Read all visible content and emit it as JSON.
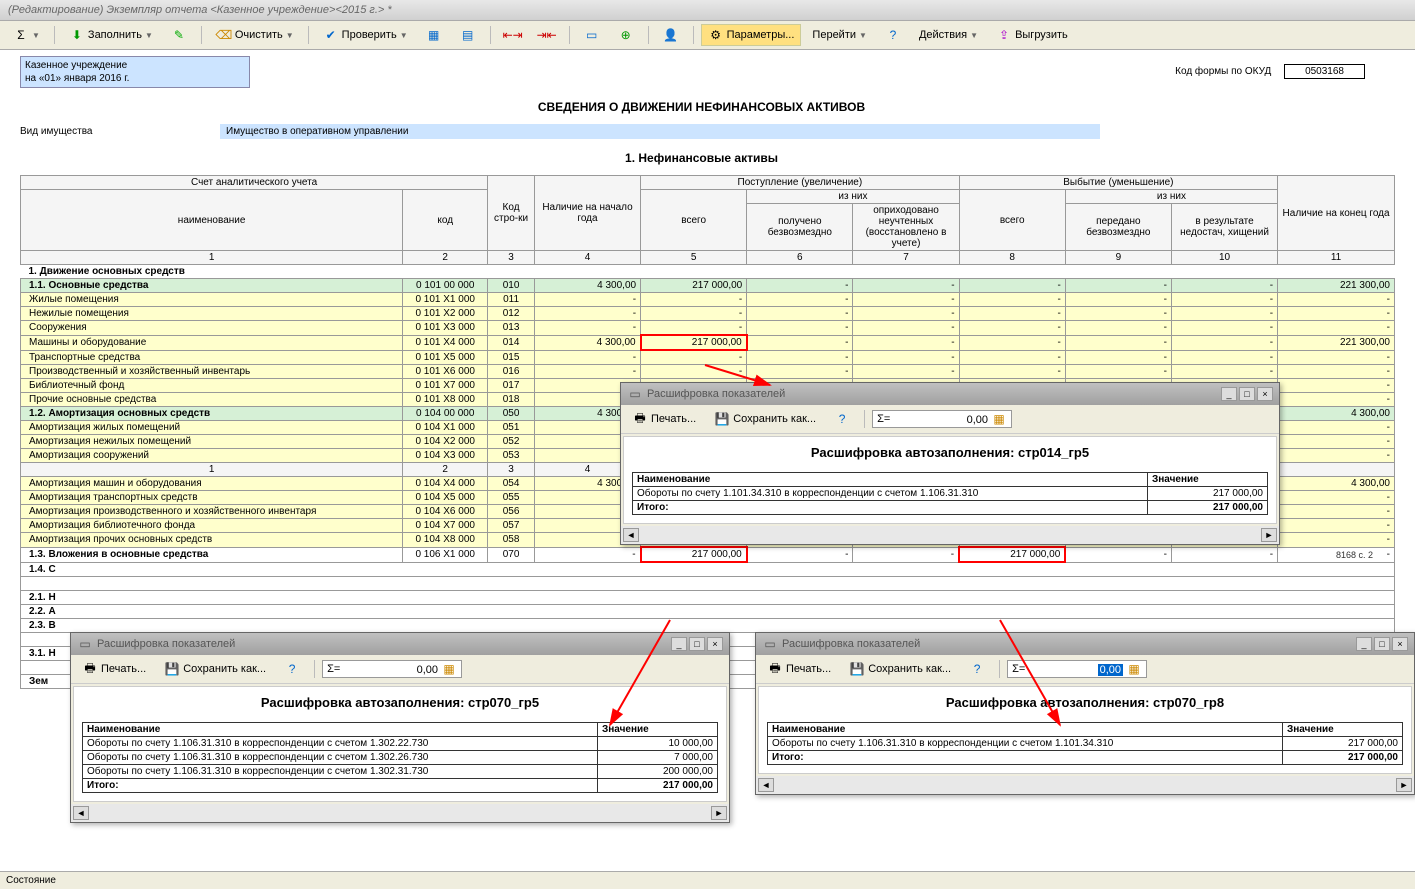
{
  "title": "(Редактирование) Экземпляр отчета <Казенное учреждение><2015 г.> *",
  "toolbar": {
    "fill": "Заполнить",
    "clear": "Очистить",
    "check": "Проверить",
    "params": "Параметры...",
    "goto": "Перейти",
    "actions": "Действия",
    "unload": "Выгрузить"
  },
  "header": {
    "org": "Казенное учреждение",
    "date": "на «01» января 2016 г.",
    "okud_label": "Код формы по ОКУД",
    "okud": "0503168",
    "main_title": "СВЕДЕНИЯ О ДВИЖЕНИИ НЕФИНАНСОВЫХ АКТИВОВ",
    "prop_label": "Вид имущества",
    "prop_value": "Имущество в оперативном управлении",
    "section_title": "1. Нефинансовые активы"
  },
  "columns": {
    "analytic": "Счет аналитического учета",
    "name": "наименование",
    "code": "код",
    "row_code": "Код стро-ки",
    "begin": "Наличие на начало года",
    "in": "Поступление (увеличение)",
    "out": "Выбытие (уменьшение)",
    "of_them": "из них",
    "total": "всего",
    "in1": "получено безвозмездно",
    "in2": "оприходовано неучтенных (восстановлено в учете)",
    "out1": "передано безвозмездно",
    "out2": "в результате недостач, хищений",
    "end": "Наличие на конец года",
    "nums": [
      "1",
      "2",
      "3",
      "4",
      "5",
      "6",
      "7",
      "8",
      "9",
      "10",
      "11"
    ]
  },
  "sections": {
    "s1": "1. Движение основных средств",
    "s11": "1.1. Основные средства",
    "s12": "1.2. Амортизация основных средств",
    "s13": "1.3. Вложения в основные средства",
    "s14": "1.4. С",
    "s21": "2.1. Н",
    "s22": "2.2. А",
    "s23": "2.3. В",
    "s31": "3.1. Н",
    "zem": "Зем"
  },
  "rows": [
    {
      "name": "Жилые помещения",
      "code": "0 101 Х1 000",
      "rc": "011"
    },
    {
      "name": "Нежилые помещения",
      "code": "0 101 Х2 000",
      "rc": "012"
    },
    {
      "name": "Сооружения",
      "code": "0 101 Х3 000",
      "rc": "013"
    },
    {
      "name": "Машины и оборудование",
      "code": "0 101 Х4 000",
      "rc": "014",
      "begin": "4 300,00",
      "c5": "217 000,00",
      "end": "221 300,00"
    },
    {
      "name": "Транспортные средства",
      "code": "0 101 Х5 000",
      "rc": "015"
    },
    {
      "name": "Производственный и хозяйственный инвентарь",
      "code": "0 101 Х6 000",
      "rc": "016"
    },
    {
      "name": "Библиотечный фонд",
      "code": "0 101 Х7 000",
      "rc": "017"
    },
    {
      "name": "Прочие основные средства",
      "code": "0 101 Х8 000",
      "rc": "018"
    }
  ],
  "row11": {
    "code": "0 101 00 000",
    "rc": "010",
    "begin": "4 300,00",
    "c5": "217 000,00",
    "end": "221 300,00"
  },
  "row12": {
    "code": "0 104 00 000",
    "rc": "050",
    "begin": "4 300,00",
    "end": "4 300,00"
  },
  "rows12": [
    {
      "name": "Амортизация жилых помещений",
      "code": "0 104 Х1 000",
      "rc": "051"
    },
    {
      "name": "Амортизация нежилых помещений",
      "code": "0 104 Х2 000",
      "rc": "052"
    },
    {
      "name": "Амортизация сооружений",
      "code": "0 104 Х3 000",
      "rc": "053"
    }
  ],
  "rows12b": [
    {
      "name": "Амортизация машин и оборудования",
      "code": "0 104 Х4 000",
      "rc": "054",
      "begin": "4 300,00",
      "end": "4 300,00"
    },
    {
      "name": "Амортизация транспортных средств",
      "code": "0 104 Х5 000",
      "rc": "055"
    },
    {
      "name": "Амортизация производственного и хозяйственного инвентаря",
      "code": "0 104 Х6 000",
      "rc": "056"
    },
    {
      "name": "Амортизация библиотечного фонда",
      "code": "0 104 Х7 000",
      "rc": "057"
    },
    {
      "name": "Амортизация прочих основных средств",
      "code": "0 104 Х8 000",
      "rc": "058"
    }
  ],
  "row13": {
    "code": "0 106 Х1 000",
    "rc": "070",
    "c5": "217 000,00",
    "c8": "217 000,00"
  },
  "pagehint": "8168 с. 2",
  "popup": {
    "title": "Расшифровка показателей",
    "print": "Печать...",
    "save": "Сохранить как...",
    "sigma": "Σ=",
    "zero": "0,00",
    "col_name": "Наименование",
    "col_val": "Значение",
    "total": "Итого:"
  },
  "p1": {
    "heading": "Расшифровка автозаполнения: стр014_гр5",
    "rows": [
      {
        "n": "Обороты по счету 1.101.34.310 в корреспонденции с счетом 1.106.31.310",
        "v": "217 000,00"
      }
    ],
    "total": "217 000,00"
  },
  "p2": {
    "heading": "Расшифровка автозаполнения: стр070_гр5",
    "rows": [
      {
        "n": "Обороты по счету 1.106.31.310 в корреспонденции с счетом 1.302.22.730",
        "v": "10 000,00"
      },
      {
        "n": "Обороты по счету 1.106.31.310 в корреспонденции с счетом 1.302.26.730",
        "v": "7 000,00"
      },
      {
        "n": "Обороты по счету 1.106.31.310 в корреспонденции с счетом 1.302.31.730",
        "v": "200 000,00"
      }
    ],
    "total": "217 000,00"
  },
  "p3": {
    "heading": "Расшифровка автозаполнения: стр070_гр8",
    "rows": [
      {
        "n": "Обороты по счету 1.106.31.310 в корреспонденции с счетом 1.101.34.310",
        "v": "217 000,00"
      }
    ],
    "total": "217 000,00"
  },
  "status": "Состояние"
}
